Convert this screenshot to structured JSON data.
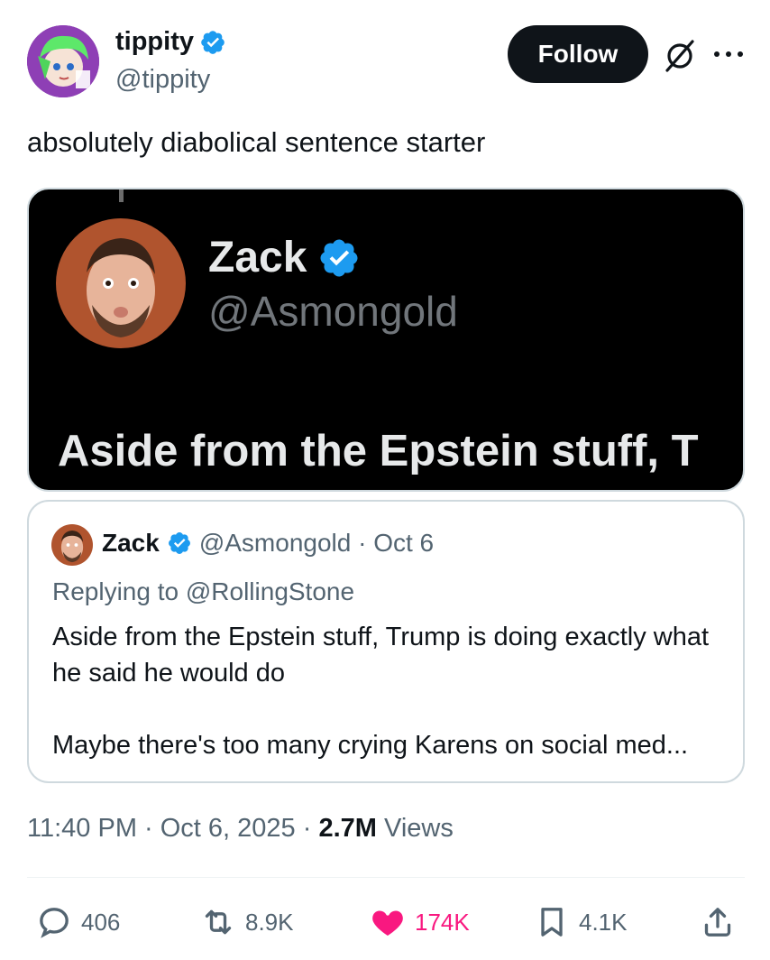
{
  "author": {
    "name": "tippity",
    "handle": "@tippity"
  },
  "follow_label": "Follow",
  "tweet_text": "absolutely diabolical sentence starter",
  "media": {
    "name": "Zack",
    "handle": "@Asmongold",
    "text": "Aside from the Epstein stuff, T"
  },
  "quoted": {
    "name": "Zack",
    "handle_date": "@Asmongold · Oct 6",
    "replying": "Replying to @RollingStone",
    "line1": "Aside from the Epstein stuff, Trump is doing exactly what he said he would do",
    "line2": "Maybe there's too many crying Karens on social med..."
  },
  "meta": {
    "timestamp": "11:40 PM · Oct 6, 2025 · ",
    "views_count": "2.7M",
    "views_label": " Views"
  },
  "actions": {
    "replies": "406",
    "reposts": "8.9K",
    "likes": "174K",
    "bookmarks": "4.1K"
  },
  "colors": {
    "verified": "#1d9bf0",
    "like": "#f91880",
    "secondary_text": "#536471"
  }
}
